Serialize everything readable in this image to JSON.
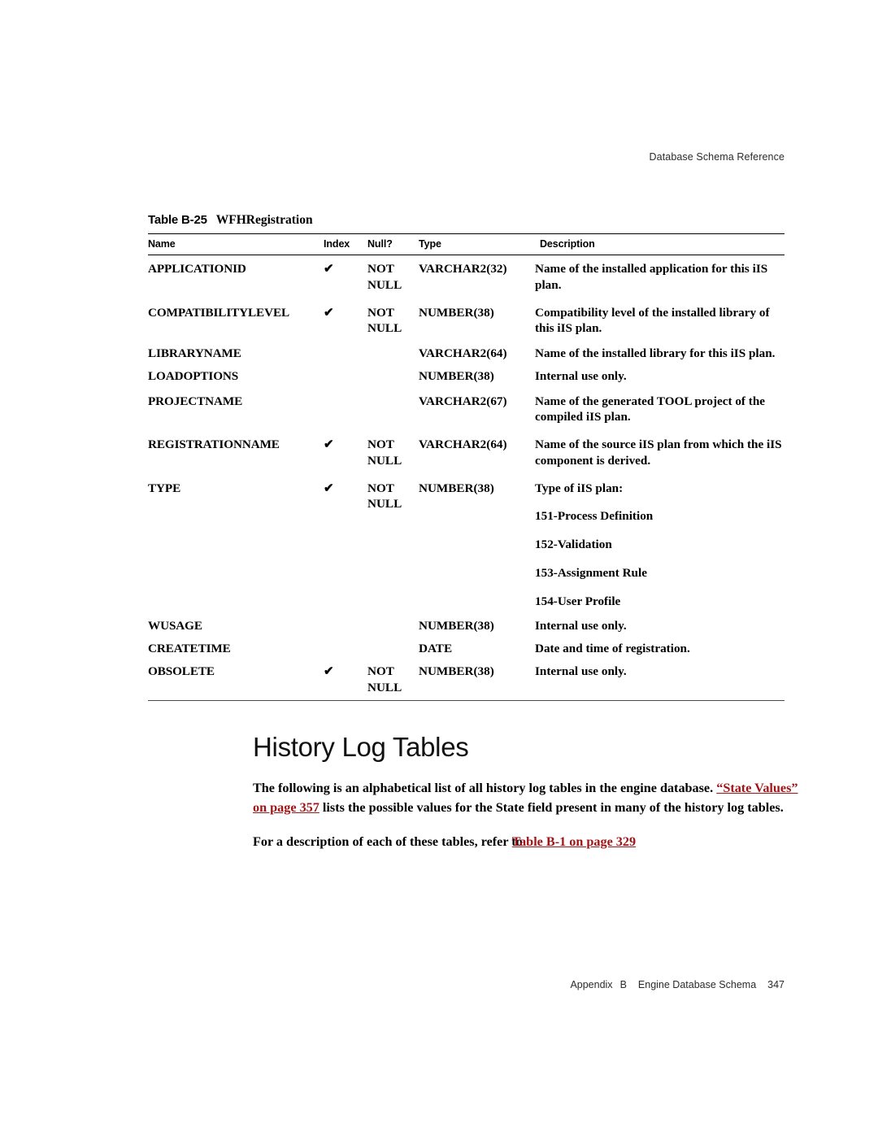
{
  "running_head": "Database Schema Reference",
  "table": {
    "caption_number": "Table B-25",
    "caption_title": "WFHRegistration",
    "columns": [
      "Name",
      "Index",
      "Null?",
      "Type",
      "Description"
    ],
    "index_mark": "✔",
    "rows": [
      {
        "name": "APPLICATIONID",
        "index": "✔",
        "null": "NOT\nNULL",
        "type": "VARCHAR2(32)",
        "description": "Name of the installed application for this iIS plan."
      },
      {
        "name": "COMPATIBILITYLEVEL",
        "index": "✔",
        "null": "NOT\nNULL",
        "type": "NUMBER(38)",
        "description": "Compatibility level of the installed library of this iIS plan."
      },
      {
        "name": "LIBRARYNAME",
        "index": "",
        "null": "",
        "type": "VARCHAR2(64)",
        "description": "Name of the installed library for this iIS plan."
      },
      {
        "name": "LOADOPTIONS",
        "index": "",
        "null": "",
        "type": "NUMBER(38)",
        "description": "Internal use only."
      },
      {
        "name": "PROJECTNAME",
        "index": "",
        "null": "",
        "type": "VARCHAR2(67)",
        "description": "Name of the generated TOOL project of the compiled iIS plan."
      },
      {
        "name": "REGISTRATIONNAME",
        "index": "✔",
        "null": "NOT\nNULL",
        "type": "VARCHAR2(64)",
        "description": "Name of the source iIS plan from which the iIS component is derived."
      },
      {
        "name": "TYPE",
        "index": "✔",
        "null": "NOT\nNULL",
        "type": "NUMBER(38)",
        "description": "Type of iIS plan:",
        "enum_values": [
          "151-Process Definition",
          "152-Validation",
          "153-Assignment Rule",
          "154-User Profile"
        ]
      },
      {
        "name": "WUSAGE",
        "index": "",
        "null": "",
        "type": "NUMBER(38)",
        "description": "Internal use only."
      },
      {
        "name": "CREATETIME",
        "index": "",
        "null": "",
        "type": "DATE",
        "description": "Date and time of registration."
      },
      {
        "name": "OBSOLETE",
        "index": "✔",
        "null": "NOT\nNULL",
        "type": "NUMBER(38)",
        "description": "Internal use only."
      }
    ]
  },
  "section": {
    "title": "History Log Tables",
    "paragraph1_part1": "The following is an alphabetical list of all history log tables in the engine database. ",
    "paragraph1_link": "“State Values” on page 357",
    "paragraph1_part2": " lists the possible values for the State field present in many of the history log tables.",
    "paragraph2_part1": "For a description of each of these tables, refer to",
    "paragraph2_link": "Table B-1 on page 329"
  },
  "footer": {
    "appendix_label": "Appendix",
    "appendix_letter": "B",
    "appendix_title": "Engine Database Schema",
    "page_number": "347"
  },
  "colors": {
    "xref_red": "#A01517",
    "text_black": "#000000"
  }
}
